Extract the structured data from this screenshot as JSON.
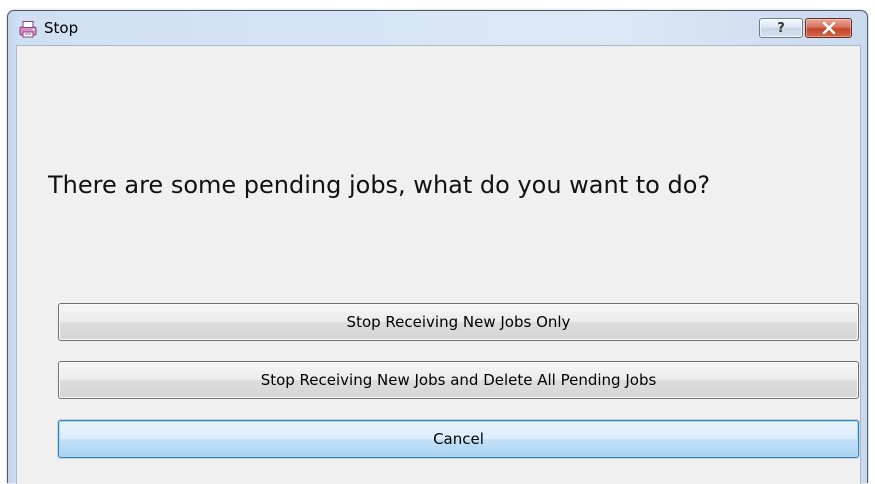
{
  "window": {
    "title": "Stop",
    "app_icon": "printer-app-icon",
    "help_label": "?",
    "close_label": "✕"
  },
  "dialog": {
    "message": "There are some pending jobs, what do you want to do?",
    "buttons": [
      {
        "label": "Stop Receiving New Jobs Only",
        "default": false
      },
      {
        "label": "Stop Receiving New Jobs and Delete All Pending Jobs",
        "default": false
      },
      {
        "label": "Cancel",
        "default": true
      }
    ]
  },
  "colors": {
    "client_background": "#f0f0f0",
    "title_frame": "#d6e5f5",
    "close_button": "#c4452a",
    "default_button_border": "#3c7fb1"
  }
}
